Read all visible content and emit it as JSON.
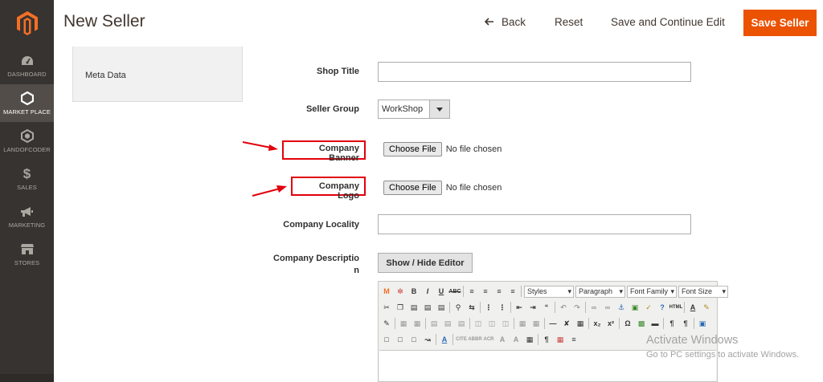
{
  "sidebar": {
    "items": [
      {
        "label": "DASHBOARD",
        "icon": "gauge-icon",
        "active": false
      },
      {
        "label": "MARKET PLACE",
        "icon": "hexagon-icon",
        "active": true
      },
      {
        "label": "LANDOFCODER",
        "icon": "landofcoder-icon",
        "active": false
      },
      {
        "label": "SALES",
        "icon": "dollar-icon",
        "active": false
      },
      {
        "label": "MARKETING",
        "icon": "megaphone-icon",
        "active": false
      },
      {
        "label": "STORES",
        "icon": "store-icon",
        "active": false
      }
    ]
  },
  "header": {
    "title": "New Seller",
    "back_label": "Back",
    "reset_label": "Reset",
    "save_continue_label": "Save and Continue Edit",
    "save_label": "Save Seller"
  },
  "tabs": {
    "meta_data": "Meta Data"
  },
  "form": {
    "shop_title": {
      "label": "Shop Title",
      "value": ""
    },
    "seller_group": {
      "label": "Seller Group",
      "value": "WorkShop"
    },
    "company_banner": {
      "label": "Company Banner",
      "button": "Choose File",
      "status": "No file chosen"
    },
    "company_logo": {
      "label": "Company Logo",
      "button": "Choose File",
      "status": "No file chosen"
    },
    "company_locality": {
      "label": "Company Locality",
      "value": ""
    },
    "company_description": {
      "label_line1": "Company Descriptio",
      "label_line2": "n",
      "toggle_label": "Show / Hide Editor"
    }
  },
  "editor": {
    "styles": "Styles",
    "paragraph": "Paragraph",
    "font_family": "Font Family",
    "font_size": "Font Size"
  },
  "watermark": {
    "title": "Activate Windows",
    "subtitle": "Go to PC settings to activate Windows."
  },
  "colors": {
    "sidebar": "#373330",
    "accent": "#eb5202",
    "highlight": "#e2000b"
  }
}
